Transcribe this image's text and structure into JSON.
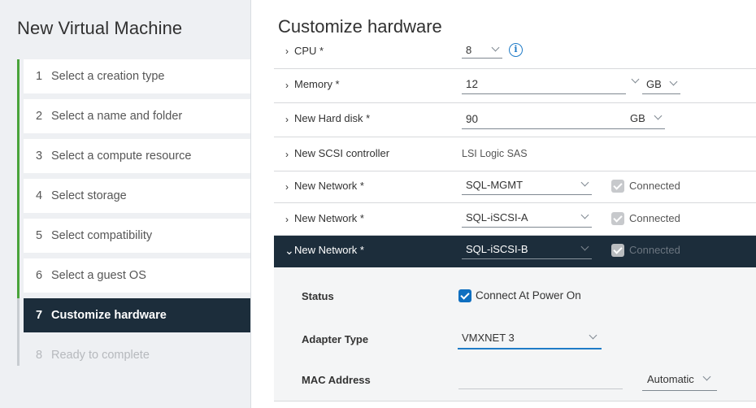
{
  "wizard": {
    "title": "New Virtual Machine",
    "steps": [
      {
        "num": "1",
        "label": "Select a creation type",
        "state": "done"
      },
      {
        "num": "2",
        "label": "Select a name and folder",
        "state": "done"
      },
      {
        "num": "3",
        "label": "Select a compute resource",
        "state": "done"
      },
      {
        "num": "4",
        "label": "Select storage",
        "state": "done"
      },
      {
        "num": "5",
        "label": "Select compatibility",
        "state": "done"
      },
      {
        "num": "6",
        "label": "Select a guest OS",
        "state": "done"
      },
      {
        "num": "7",
        "label": "Customize hardware",
        "state": "active"
      },
      {
        "num": "8",
        "label": "Ready to complete",
        "state": "pending"
      }
    ]
  },
  "main": {
    "title": "Customize hardware"
  },
  "hardware": {
    "cpu": {
      "label": "CPU *",
      "value": "8"
    },
    "memory": {
      "label": "Memory *",
      "value": "12",
      "unit": "GB"
    },
    "hard_disk": {
      "label": "New Hard disk *",
      "value": "90",
      "unit": "GB"
    },
    "scsi": {
      "label": "New SCSI controller",
      "value": "LSI Logic SAS"
    },
    "networks": [
      {
        "label": "New Network *",
        "value": "SQL-MGMT",
        "connected_label": "Connected",
        "expanded": false
      },
      {
        "label": "New Network *",
        "value": "SQL-iSCSI-A",
        "connected_label": "Connected",
        "expanded": false
      },
      {
        "label": "New Network *",
        "value": "SQL-iSCSI-B",
        "connected_label": "Connected",
        "expanded": true
      }
    ],
    "network_details": {
      "status_label": "Status",
      "status_value": "Connect At Power On",
      "adapter_label": "Adapter Type",
      "adapter_value": "VMXNET 3",
      "mac_label": "MAC Address",
      "mac_value": "",
      "mac_mode": "Automatic"
    }
  },
  "colors": {
    "active_step_bg": "#1c2d3b",
    "done_marker": "#49a33a",
    "checkbox_checked": "#0f6fc0",
    "info_blue": "#1f7bc7"
  },
  "icons": {
    "chevron_collapsed": "›",
    "chevron_expanded": "⌄",
    "info": "i"
  }
}
